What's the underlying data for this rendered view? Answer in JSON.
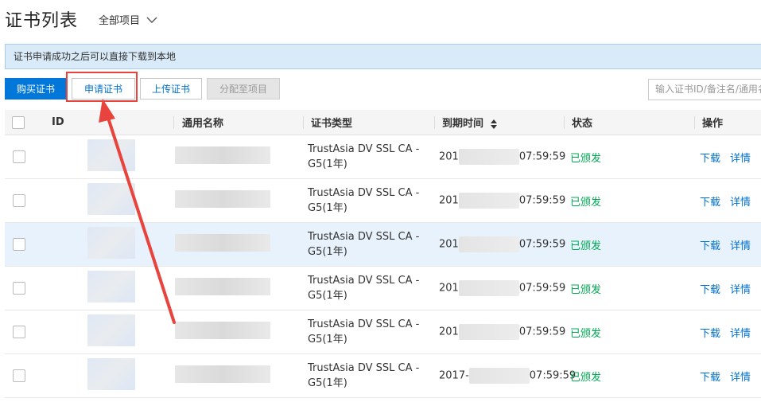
{
  "header": {
    "title": "证书列表",
    "project_selector": "全部项目"
  },
  "notice": "证书申请成功之后可以直接下载到本地",
  "toolbar": {
    "buy_label": "购买证书",
    "apply_label": "申请证书",
    "upload_label": "上传证书",
    "assign_label": "分配至项目",
    "search_placeholder": "输入证书ID/备注名/通用名"
  },
  "table": {
    "columns": [
      "ID",
      "通用名称",
      "证书类型",
      "到期时间",
      "状态",
      "操作"
    ],
    "rows": [
      {
        "type_line1": "TrustAsia DV SSL CA -",
        "type_line2": "G5(1年)",
        "date_prefix": "201",
        "date_suffix": "07:59:59",
        "status": "已颁发",
        "download": "下载",
        "details": "详情"
      },
      {
        "type_line1": "TrustAsia DV SSL CA -",
        "type_line2": "G5(1年)",
        "date_prefix": "201",
        "date_suffix": "07:59:59",
        "status": "已颁发",
        "download": "下载",
        "details": "详情"
      },
      {
        "type_line1": "TrustAsia DV SSL CA -",
        "type_line2": "G5(1年)",
        "date_prefix": "201",
        "date_suffix": "07:59:59",
        "status": "已颁发",
        "download": "下载",
        "details": "详情"
      },
      {
        "type_line1": "TrustAsia DV SSL CA -",
        "type_line2": "G5(1年)",
        "date_prefix": "201",
        "date_suffix": "07:59:59",
        "status": "已颁发",
        "download": "下载",
        "details": "详情"
      },
      {
        "type_line1": "TrustAsia DV SSL CA -",
        "type_line2": "G5(1年)",
        "date_prefix": "201",
        "date_suffix": "07:59:59",
        "status": "已颁发",
        "download": "下载",
        "details": "详情"
      },
      {
        "type_line1": "TrustAsia DV SSL CA -",
        "type_line2": "G5(1年)",
        "date_prefix": "2017-",
        "date_suffix": "07:59:59",
        "status": "已颁发",
        "download": "下载",
        "details": "详情"
      }
    ]
  },
  "colors": {
    "accent": "#0077d9",
    "status_ok": "#00a854",
    "annotation": "#e8433c"
  },
  "icons": {
    "project_dropdown": "chevron-down-icon",
    "sort": "sort-icon"
  }
}
